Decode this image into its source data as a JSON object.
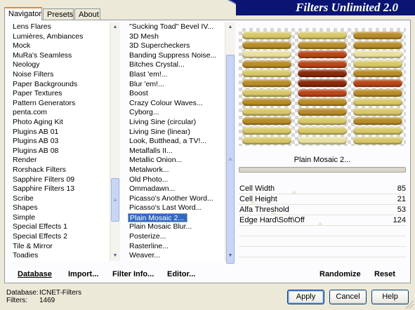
{
  "window": {
    "title": "Filters Unlimited 2.0",
    "tabs": [
      "Navigator",
      "Presets",
      "About"
    ],
    "active_tab": "Navigator"
  },
  "categories": {
    "items": [
      "Lens Flares",
      "Lumières, Ambiances",
      "Mock",
      "MuRa's Seamless",
      "Neology",
      "Noise Filters",
      "Paper Backgrounds",
      "Paper Textures",
      "Pattern Generators",
      "penta.com",
      "Photo Aging Kit",
      "Plugins AB 01",
      "Plugins AB 03",
      "Plugins AB 08",
      "Render",
      "Rorshack Filters",
      "Sapphire Filters 09",
      "Sapphire Filters 13",
      "Scribe",
      "Shapes",
      "Simple",
      "Special Effects 1",
      "Special Effects 2",
      "Tile & Mirror",
      "Toadies"
    ]
  },
  "filters": {
    "items": [
      "\"Sucking Toad\"  Bevel IV...",
      "3D Mesh",
      "3D Supercheckers",
      "Banding Suppress Noise...",
      "Bitches Crystal...",
      "Blast 'em!...",
      "Blur 'em!...",
      "Boost",
      "Crazy Colour Waves...",
      "Cyborg...",
      "Living Sine (circular)",
      "Living Sine (linear)",
      "Look, Butthead, a TV!...",
      "Metalfalls II...",
      "Metallic Onion...",
      "Metalwork...",
      "Old Photo...",
      "Ommadawn...",
      "Picasso's Another Word...",
      "Picasso's Last Word...",
      "Plain Mosaic 2...",
      "Plain Mosaic Blur...",
      "Posterize...",
      "Rasterline...",
      "Weaver..."
    ],
    "selected": "Plain Mosaic 2..."
  },
  "preview": {
    "filter_name": "Plain Mosaic 2...",
    "colors": {
      "dark_red": "#8a2a0a",
      "red": "#b8471a",
      "gold": "#b88d2a",
      "yellow": "#d8c86a",
      "pale": "#e8e0a0"
    }
  },
  "params": [
    {
      "label": "Cell Width",
      "value": "85",
      "level": 0.333
    },
    {
      "label": "Cell Height",
      "value": "21",
      "level": 0.082
    },
    {
      "label": "Alfa Threshold",
      "value": "53",
      "level": 0.208
    },
    {
      "label": "Edge Hard\\Soft\\Off",
      "value": "124",
      "level": 0.486
    }
  ],
  "toolbar": {
    "database": "Database",
    "import": "Import...",
    "filter_info": "Filter Info...",
    "editor": "Editor...",
    "randomize": "Randomize",
    "reset": "Reset"
  },
  "status": {
    "database_label": "Database:",
    "database_value": "ICNET-Filters",
    "filters_label": "Filters:",
    "filters_value": "1469"
  },
  "buttons": {
    "apply": "Apply",
    "cancel": "Cancel",
    "help": "Help"
  }
}
